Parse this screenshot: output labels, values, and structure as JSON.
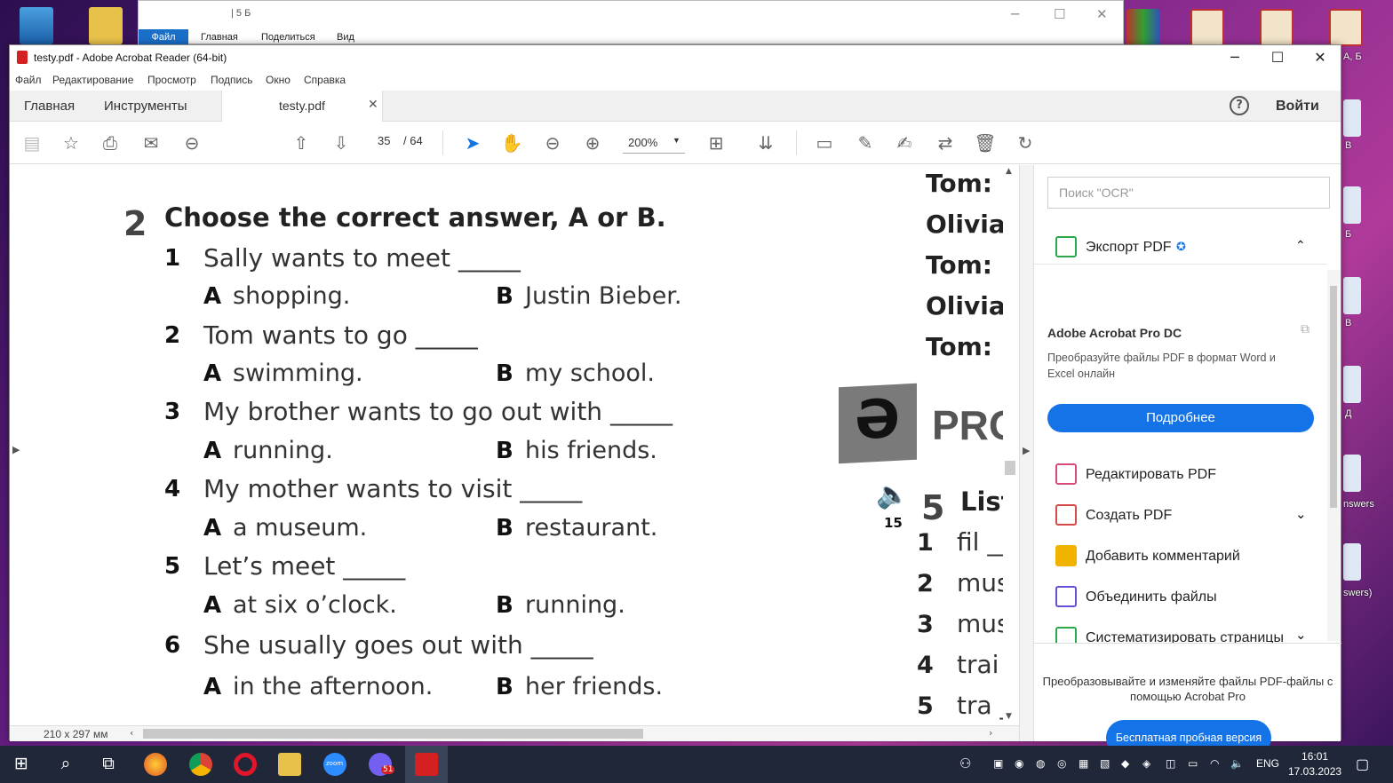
{
  "explorer": {
    "quick_title": "| 5 Б",
    "tabs": [
      "Файл",
      "Главная",
      "Поделиться",
      "Вид"
    ]
  },
  "desktop": {
    "labels": [
      "А, Б",
      "В",
      "Б",
      "В",
      "Д",
      "nswers",
      "swers)"
    ]
  },
  "window": {
    "title": "testy.pdf - Adobe Acrobat Reader (64-bit)"
  },
  "menu": [
    "Файл",
    "Редактирование",
    "Просмотр",
    "Подпись",
    "Окно",
    "Справка"
  ],
  "tabs": {
    "home": "Главная",
    "tools": "Инструменты",
    "doc": "testy.pdf",
    "login": "Войти",
    "help": "?"
  },
  "toolbar": {
    "page_current": "35",
    "page_total": "/ 64",
    "zoom": "200%"
  },
  "page": {
    "exercise_number": "2",
    "exercise_title": "Choose the correct answer, A or B.",
    "questions": [
      {
        "num": "1",
        "text": "Sally wants to meet _____",
        "a": "shopping.",
        "b": "Justin Bieber."
      },
      {
        "num": "2",
        "text": "Tom wants to go _____",
        "a": "swimming.",
        "b": "my school."
      },
      {
        "num": "3",
        "text": "My brother wants to go out with _____",
        "a": "running.",
        "b": "his friends."
      },
      {
        "num": "4",
        "text": "My mother wants to visit _____",
        "a": "a museum.",
        "b": "restaurant."
      },
      {
        "num": "5",
        "text": "Let’s meet _____",
        "a": "at six o’clock.",
        "b": "running."
      },
      {
        "num": "6",
        "text": "She usually goes out with _____",
        "a": "in the afternoon.",
        "b": "her friends."
      }
    ],
    "letter_a": "A",
    "letter_b": "B",
    "dialogue": [
      "Tom:",
      "Olivia:",
      "Tom:",
      "Olivia:",
      "Tom:"
    ],
    "badge_glyph": "Ә",
    "badge_text": "PRO",
    "audio_track": "15",
    "exercise5_number": "5",
    "exercise5_title": "List",
    "list": [
      {
        "num": "1",
        "word": "fil ___"
      },
      {
        "num": "2",
        "word": "mus"
      },
      {
        "num": "3",
        "word": "mus"
      },
      {
        "num": "4",
        "word": "trai"
      },
      {
        "num": "5",
        "word": "tra _"
      }
    ]
  },
  "status": {
    "page_size": "210 x 297 мм"
  },
  "panel": {
    "search_placeholder": "Поиск \"OCR\"",
    "export_label": "Экспорт PDF",
    "promo_title": "Adobe Acrobat Pro DC",
    "promo_desc": "Преобразуйте файлы PDF в формат Word и Excel онлайн",
    "more_button": "Подробнее",
    "tools": [
      {
        "label": "Редактировать PDF",
        "color": "#d94a7a"
      },
      {
        "label": "Создать PDF",
        "color": "#d94a4a"
      },
      {
        "label": "Добавить комментарий",
        "color": "#f0b400"
      },
      {
        "label": "Объединить файлы",
        "color": "#6b4fd9"
      },
      {
        "label": "Систематизировать страницы",
        "color": "#2aa84a"
      }
    ],
    "bottom_text": "Преобразовывайте и изменяйте файлы PDF-файлы с помощью Acrobat Pro",
    "trial_button": "Бесплатная пробная версия"
  },
  "taskbar": {
    "lang": "ENG",
    "time": "16:01",
    "date": "17.03.2023",
    "badge": "51",
    "zoom_label": "zoom"
  },
  "colors": {
    "accent": "#1473e6",
    "taskbar": "#1f2738",
    "acrobat_red": "#d42020"
  }
}
